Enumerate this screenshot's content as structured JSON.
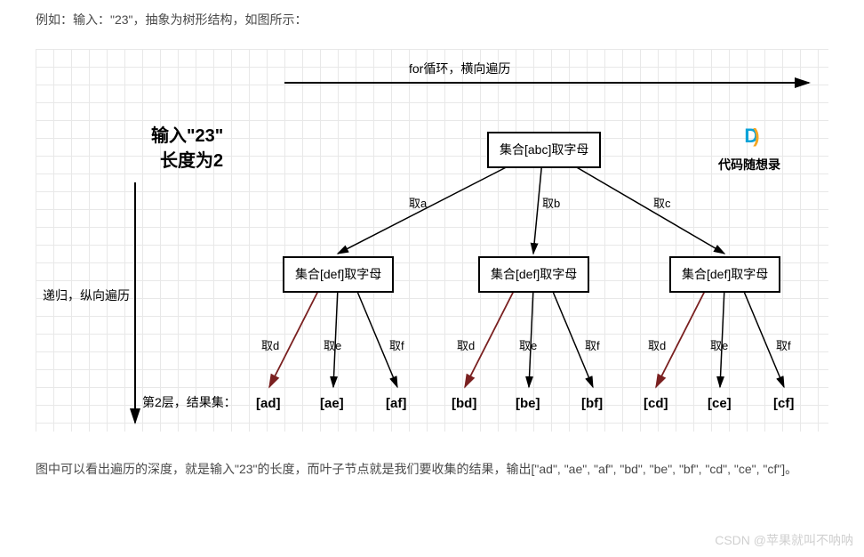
{
  "intro_text": "例如：输入：\"23\"，抽象为树形结构，如图所示：",
  "top_arrow_label": "for循环，横向遍历",
  "input_title_l1": "输入\"23\"",
  "input_title_l2": "长度为2",
  "side_label": "递归，纵向遍历",
  "root_node": "集合[abc]取字母",
  "mid_node": "集合[def]取字母",
  "edge_l1": {
    "a": "取a",
    "b": "取b",
    "c": "取c"
  },
  "edge_l2": {
    "d": "取d",
    "e": "取e",
    "f": "取f"
  },
  "result_row_label": "第2层，结果集：",
  "leaves": [
    "[ad]",
    "[ae]",
    "[af]",
    "[bd]",
    "[be]",
    "[bf]",
    "[cd]",
    "[ce]",
    "[cf]"
  ],
  "brand": "代码随想录",
  "conclusion": "图中可以看出遍历的深度，就是输入\"23\"的长度，而叶子节点就是我们要收集的结果，输出[\"ad\", \"ae\", \"af\", \"bd\", \"be\", \"bf\", \"cd\", \"ce\", \"cf\"]。",
  "csdn_watermark": "CSDN @苹果就叫不呐呐"
}
